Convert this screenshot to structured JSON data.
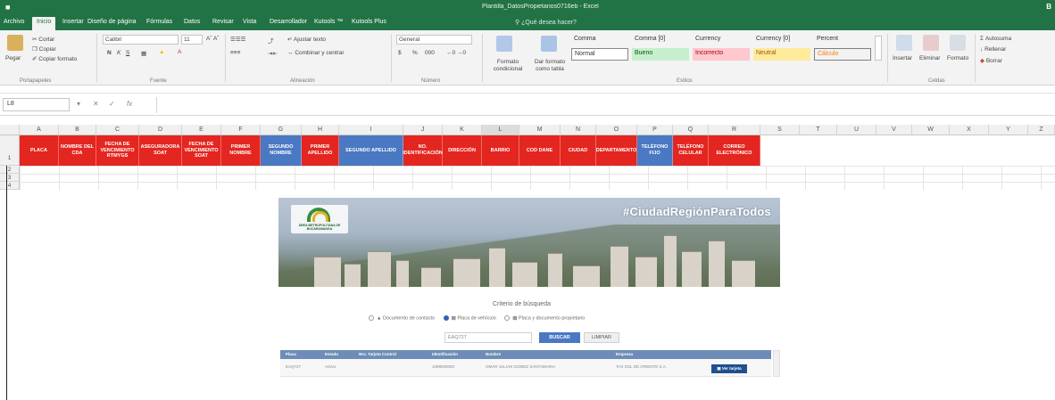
{
  "window": {
    "title": "Plantilla_DatosPropietarios0716eb - Excel"
  },
  "ribbon_tabs": [
    {
      "label": "Archivo"
    },
    {
      "label": "Inicio"
    },
    {
      "label": "Insertar"
    },
    {
      "label": "Diseño de página"
    },
    {
      "label": "Fórmulas"
    },
    {
      "label": "Datos"
    },
    {
      "label": "Revisar"
    },
    {
      "label": "Vista"
    },
    {
      "label": "Desarrollador"
    },
    {
      "label": "Kutools ™"
    },
    {
      "label": "Kutools Plus"
    }
  ],
  "tell_me": "¿Qué desea hacer?",
  "clipboard": {
    "cut": "Cortar",
    "copy": "Copiar",
    "paste": "Pegar",
    "format_painter": "Copiar formato",
    "group": "Portapapeles"
  },
  "font": {
    "name": "Calibri",
    "size": "11",
    "bold": "N",
    "italic": "K",
    "underline": "S",
    "group": "Fuente"
  },
  "alignment": {
    "wrap": "Ajustar texto",
    "merge": "Combinar y centrar",
    "group": "Alineación"
  },
  "number": {
    "format": "General",
    "currency": "$",
    "percent": "%",
    "thousands": "000",
    "group": "Número"
  },
  "styles": {
    "conditional": "Formato condicional",
    "as_table": "Dar formato como tabla",
    "cells": [
      {
        "label": "Comma",
        "bg": "#ffffff",
        "fg": "#333333"
      },
      {
        "label": "Comma [0]",
        "bg": "#ffffff",
        "fg": "#333333"
      },
      {
        "label": "Currency",
        "bg": "#ffffff",
        "fg": "#333333"
      },
      {
        "label": "Currency [0]",
        "bg": "#ffffff",
        "fg": "#333333"
      },
      {
        "label": "Percent",
        "bg": "#ffffff",
        "fg": "#333333"
      },
      {
        "label": "Normal",
        "bg": "#ffffff",
        "fg": "#333333"
      },
      {
        "label": "Bueno",
        "bg": "#c6efce",
        "fg": "#006100"
      },
      {
        "label": "Incorrecto",
        "bg": "#ffc7ce",
        "fg": "#9c0006"
      },
      {
        "label": "Neutral",
        "bg": "#ffeb9c",
        "fg": "#9c5700"
      },
      {
        "label": "Cálculo",
        "bg": "#f2f2f2",
        "fg": "#fa7d00"
      }
    ],
    "group": "Estilos"
  },
  "cells_group": {
    "insert": "Insertar",
    "delete": "Eliminar",
    "format": "Formato",
    "group": "Celdas"
  },
  "editing": {
    "autosum": "Autosuma",
    "fill": "Rellenar",
    "clear": "Borrar"
  },
  "formula_bar": {
    "name_box": "L8",
    "fx": "fx",
    "value": ""
  },
  "columns": [
    "A",
    "B",
    "C",
    "D",
    "E",
    "F",
    "G",
    "H",
    "I",
    "J",
    "K",
    "L",
    "M",
    "N",
    "O",
    "P",
    "Q",
    "R",
    "S",
    "T",
    "U",
    "V",
    "W",
    "X",
    "Y",
    "Z"
  ],
  "rows": [
    "1",
    "2",
    "3",
    "4"
  ],
  "header_cells": [
    {
      "text": "PLACA",
      "color": "red"
    },
    {
      "text": "NOMBRE DEL CDA",
      "color": "red"
    },
    {
      "text": "FECHA DE VENCIMIENTO RTMYGS",
      "color": "red"
    },
    {
      "text": "ASEGURADORA SOAT",
      "color": "red"
    },
    {
      "text": "FECHA DE VENCIMIENTO SOAT",
      "color": "red"
    },
    {
      "text": "PRIMER NOMBRE",
      "color": "red"
    },
    {
      "text": "SEGUNDO NOMBRE",
      "color": "blue"
    },
    {
      "text": "PRIMER APELLIDO",
      "color": "red"
    },
    {
      "text": "SEGUNDO APELLIDO",
      "color": "blue"
    },
    {
      "text": "NO. IDENTIFICACIÓN",
      "color": "red"
    },
    {
      "text": "DIRECCIÓN",
      "color": "red"
    },
    {
      "text": "BARRIO",
      "color": "red"
    },
    {
      "text": "COD DANE",
      "color": "red"
    },
    {
      "text": "CIUDAD",
      "color": "red"
    },
    {
      "text": "DEPARTAMENTO",
      "color": "red"
    },
    {
      "text": "TELÉFONO FIJO",
      "color": "blue"
    },
    {
      "text": "TELÉFONO CELULAR",
      "color": "red"
    },
    {
      "text": "CORREO ELECTRÓNICO",
      "color": "red"
    }
  ],
  "web": {
    "hashtag": "#CiudadRegiónParaTodos",
    "logo_text": "ÁREA METROPOLITANA DE BUCARAMANGA",
    "criteria_title": "Criterio de búsqueda",
    "radio_options": [
      {
        "label": "Documento de contacto",
        "selected": false
      },
      {
        "label": "Placa de vehículo",
        "selected": true
      },
      {
        "label": "Placa y documento propietario",
        "selected": false
      }
    ],
    "plate_value": "EAQ727",
    "search_button": "BUSCAR",
    "clear_button": "LIMPIAR",
    "table_headers": [
      "Placa",
      "Estado",
      "Nro. Tarjeta Control",
      "Identificación",
      "Nombre",
      "Empresa"
    ],
    "table_row": {
      "placa": "EAQ727",
      "estado": "Activo",
      "tarjeta": "",
      "identificacion": "1098000000",
      "nombre": "OMAR JULIAN GOMEZ SANTAMARIA",
      "empresa": "TAX SOL DE ORIENTE S.A."
    },
    "card_button": "Ver tarjeta"
  },
  "colors": {
    "excel_green": "#217346",
    "header_red": "#e3261f",
    "header_blue": "#4a78c2"
  }
}
